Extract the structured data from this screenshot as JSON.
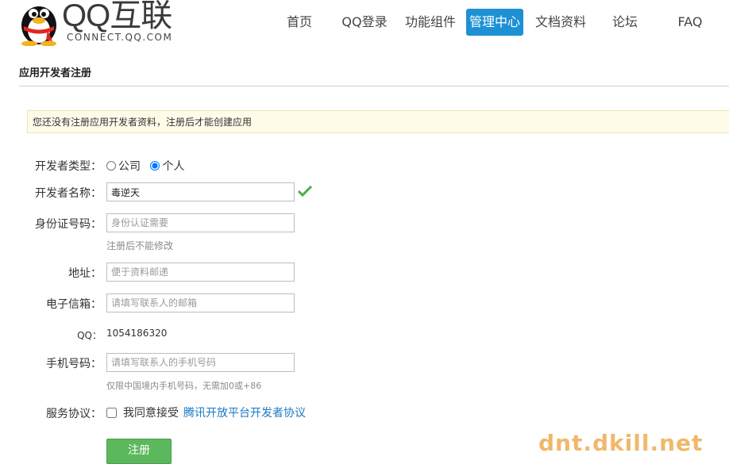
{
  "header": {
    "logo_title": "QQ互联",
    "logo_subtitle": "CONNECT.QQ.COM",
    "nav": [
      {
        "label": "首页"
      },
      {
        "label": "QQ登录"
      },
      {
        "label": "功能组件"
      },
      {
        "label": "管理中心",
        "active": true
      },
      {
        "label": "文档资料"
      },
      {
        "label": "论坛"
      },
      {
        "label": "FAQ"
      }
    ]
  },
  "page": {
    "section_title": "应用开发者注册",
    "notice": "您还没有注册应用开发者资料，注册后才能创建应用"
  },
  "form": {
    "type": {
      "label": "开发者类型：",
      "options": [
        "公司",
        "个人"
      ],
      "selected": "个人"
    },
    "name": {
      "label": "开发者名称：",
      "value": "毒逆天"
    },
    "id_number": {
      "label": "身份证号码：",
      "placeholder": "身份认证需要",
      "hint": "注册后不能修改"
    },
    "address": {
      "label": "地址：",
      "placeholder": "便于资料邮递"
    },
    "email": {
      "label": "电子信箱：",
      "placeholder": "请填写联系人的邮箱"
    },
    "qq": {
      "label": "QQ：",
      "value": "1054186320"
    },
    "phone": {
      "label": "手机号码：",
      "placeholder": "请填写联系人的手机号码",
      "hint": "仅限中国境内手机号码，无需加0或+86"
    },
    "agreement": {
      "label": "服务协议：",
      "text": "我同意接受",
      "link": "腾讯开放平台开发者协议"
    },
    "submit_label": "注册"
  },
  "watermark": "dnt.dkill.net",
  "colors": {
    "accent": "#1e90d4",
    "notice_bg": "#fffbe9",
    "link": "#1a79c4",
    "submit": "#5cb85c",
    "valid": "#4caf50"
  }
}
